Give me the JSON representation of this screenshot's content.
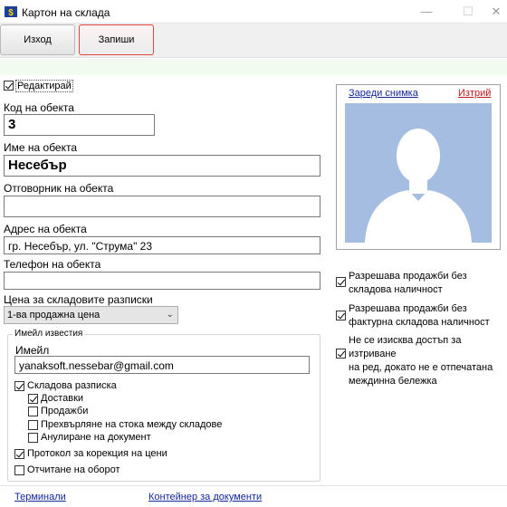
{
  "window": {
    "title": "Картон на склада",
    "minimize_glyph": "—",
    "maximize_glyph": "☐",
    "close_glyph": "✕",
    "icon": "warehouse-app-icon"
  },
  "toolbar": {
    "exit_label": "Изход",
    "save_label": "Запиши"
  },
  "form": {
    "edit_checkbox_label": "Редактирай",
    "edit_checked": true,
    "code_label": "Код на обекта",
    "code_value": "3",
    "name_label": "Име на обекта",
    "name_value": "Несебър",
    "manager_label": "Отговорник на обекта",
    "manager_value": "",
    "address_label": "Адрес на обекта",
    "address_value": "гр. Несебър, ул. \"Струма\" 23",
    "phone_label": "Телефон на обекта",
    "phone_value": "",
    "price_label": "Цена за складовите разписки",
    "price_selected": "1-ва продажна цена"
  },
  "email_group": {
    "title": "Имейл известия",
    "email_label": "Имейл",
    "email_value": "yanaksoft.nessebar@gmail.com",
    "stock_receipt_label": "Складова разписка",
    "deliveries_label": "Доставки",
    "sales_label": "Продажби",
    "transfer_label": "Прехвърляне на стока между складове",
    "cancel_doc_label": "Анулиране на документ",
    "price_protocol_label": "Протокол за корекция на цени",
    "turnover_label": "Отчитане на оборот"
  },
  "photo": {
    "load_link": "Зареди снимка",
    "delete_link": "Изтрий"
  },
  "options": {
    "allow_sales_no_stock_line1": "Разрешава продажби без",
    "allow_sales_no_stock_line2": "складова наличност",
    "allow_sales_no_invoice_line1": "Разрешава продажби без",
    "allow_sales_no_invoice_line2": "фактурна складова наличност",
    "no_delete_access_line1": "Не се изисква достъп за изтриване",
    "no_delete_access_line2": "на ред, докато не е отпечатана",
    "no_delete_access_line3": "междинна бележка"
  },
  "footer": {
    "terminals_link": "Терминали",
    "doc_container_link": "Контейнер за документи"
  },
  "colors": {
    "link_blue": "#12279b",
    "delete_red": "#c0191c",
    "save_border": "#e04545",
    "photo_bg": "#a4bde0"
  }
}
